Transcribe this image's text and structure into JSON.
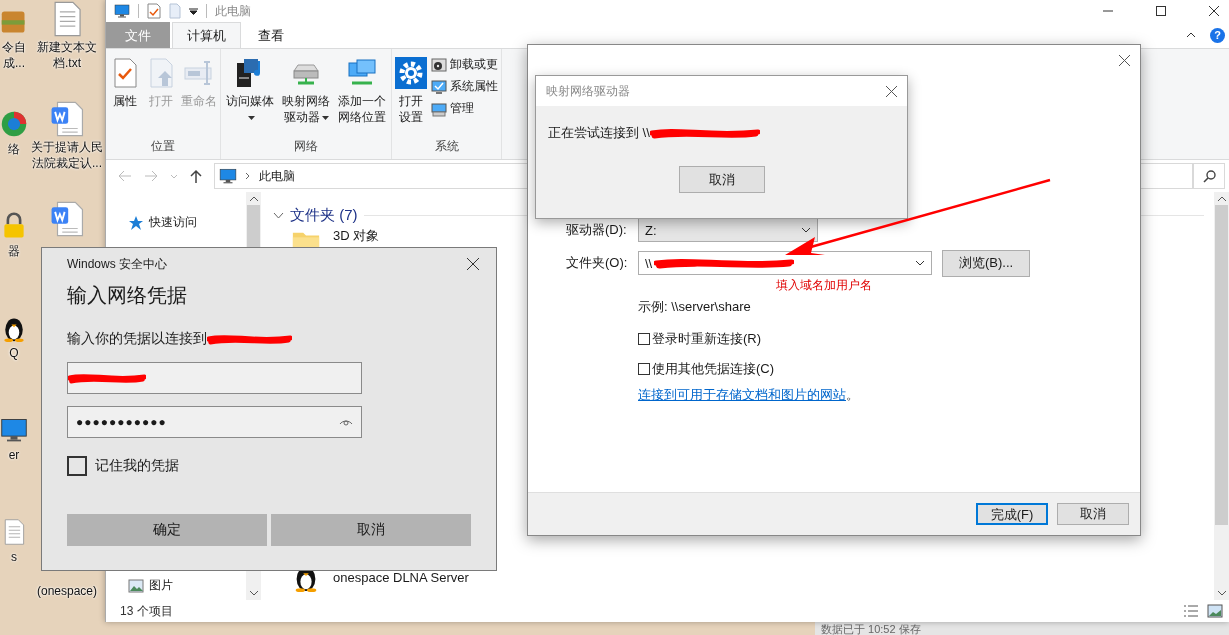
{
  "desktop": {
    "edge_icons": [
      {
        "label": "令自成..."
      },
      {
        "label": "络"
      },
      {
        "label": "器"
      },
      {
        "label": "Q"
      },
      {
        "label": "er"
      },
      {
        "label": "s"
      }
    ],
    "icons": [
      {
        "label": "新建文本文档.txt"
      },
      {
        "label": "关于提请人民法院裁定认..."
      },
      {
        "kind": "word"
      },
      {
        "label": "(onespace)"
      }
    ]
  },
  "explorer": {
    "title": "此电脑",
    "help": "?",
    "tabs": [
      {
        "label": "文件",
        "kind": "file",
        "selected": false
      },
      {
        "label": "计算机",
        "kind": "tab",
        "selected": true
      },
      {
        "label": "查看",
        "kind": "tab",
        "selected": false
      }
    ],
    "ribbon": [
      {
        "label": "位置",
        "items": [
          {
            "kind": "large",
            "label": "属性",
            "disabled": false,
            "dropdown": false
          },
          {
            "kind": "large",
            "label": "打开",
            "disabled": true,
            "dropdown": false
          },
          {
            "kind": "large",
            "label": "重命名",
            "disabled": true,
            "dropdown": false
          }
        ]
      },
      {
        "label": "网络",
        "items": [
          {
            "kind": "large",
            "label": "访问媒体",
            "disabled": false,
            "dropdown": true
          },
          {
            "kind": "large",
            "label": "映射网络驱动器",
            "disabled": false,
            "dropdown": true
          },
          {
            "kind": "large",
            "label": "添加一个网络位置",
            "disabled": false,
            "dropdown": false
          }
        ]
      },
      {
        "label": "系统",
        "items": [
          {
            "kind": "large",
            "label": "打开设置",
            "disabled": false,
            "dropdown": false
          },
          {
            "kind": "stack",
            "items": [
              {
                "label": "卸载或更"
              },
              {
                "label": "系统属性"
              },
              {
                "label": "管理"
              }
            ]
          }
        ]
      }
    ],
    "address": {
      "path": "此电脑"
    },
    "nav": [
      {
        "label": "快速访问"
      },
      {
        "label": "图片"
      }
    ],
    "sections": [
      {
        "title": "文件夹 (7)",
        "items": [
          {
            "label": "3D 对象"
          }
        ]
      },
      {
        "items": [
          {
            "label": "onespace DLNA Server"
          }
        ]
      }
    ],
    "status": "13 个项目"
  },
  "background_window": {
    "status": "数据已于 10:52 保存"
  },
  "map_drive_dialog": {
    "drive_label": "驱动器(D):",
    "drive_value": "Z:",
    "folder_label": "文件夹(O):",
    "folder_value": "\\\\",
    "browse_button": "浏览(B)...",
    "example": "示例: \\\\server\\share",
    "options": [
      {
        "label": "登录时重新连接(R)",
        "checked": false
      },
      {
        "label": "使用其他凭据连接(C)",
        "checked": false
      }
    ],
    "link": "连接到可用于存储文档和图片的网站",
    "link_suffix": "。",
    "buttons": [
      {
        "label": "完成(F)",
        "selected": true
      },
      {
        "label": "取消",
        "selected": false
      }
    ]
  },
  "progress_dialog": {
    "title": "映射网络驱动器",
    "message": "正在尝试连接到 \\\\",
    "cancel": "取消"
  },
  "security_dialog": {
    "app": "Windows 安全中心",
    "title": "输入网络凭据",
    "prompt": "输入你的凭据以连接到",
    "password": "●●●●●●●●●●●",
    "remember": {
      "label": "记住我的凭据",
      "checked": false
    },
    "buttons": [
      "确定",
      "取消"
    ]
  },
  "annotation": {
    "note": "填入域名加用户名"
  }
}
